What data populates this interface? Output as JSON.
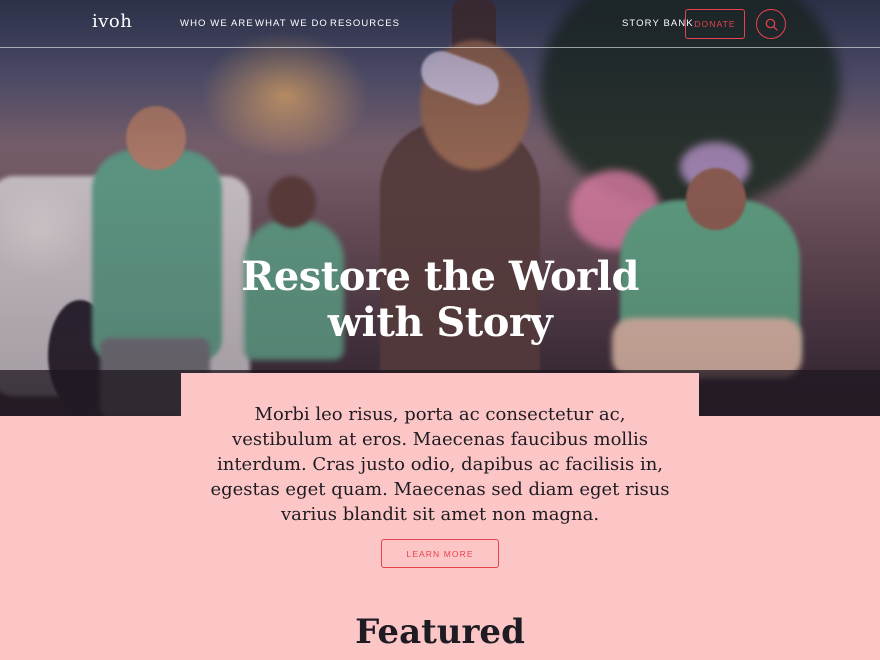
{
  "header": {
    "logo": "ivoh",
    "nav": [
      {
        "label": "WHO WE ARE"
      },
      {
        "label": "WHAT WE DO"
      },
      {
        "label": "RESOURCES"
      }
    ],
    "story_bank": "STORY BANK",
    "donate": "DONATE",
    "search_icon": "search-icon"
  },
  "hero": {
    "title_line1": "Restore the World",
    "title_line2": "with Story",
    "image": "festival-crowd-photo"
  },
  "intro": {
    "text": "Morbi leo risus, porta ac consectetur ac, vestibulum at eros. Maecenas faucibus mollis interdum. Cras justo odio, dapibus ac facilisis in, egestas eget quam. Maecenas sed diam eget risus varius blandit sit amet non magna.",
    "button": "LEARN MORE"
  },
  "featured": {
    "heading": "Featured"
  },
  "colors": {
    "accent": "#e8424e",
    "background": "#fcc6c6",
    "text": "#1e1c22"
  }
}
